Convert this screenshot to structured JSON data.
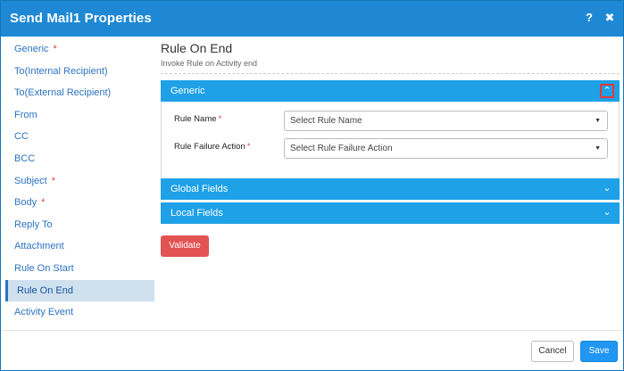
{
  "dialog": {
    "title": "Send Mail1 Properties",
    "help_icon": "?",
    "close_icon": "✖"
  },
  "sidebar": {
    "items": [
      {
        "label": "Generic",
        "required": "*"
      },
      {
        "label": "To(Internal Recipient)",
        "required": ""
      },
      {
        "label": "To(External Recipient)",
        "required": ""
      },
      {
        "label": "From",
        "required": ""
      },
      {
        "label": "CC",
        "required": ""
      },
      {
        "label": "BCC",
        "required": ""
      },
      {
        "label": "Subject",
        "required": "*"
      },
      {
        "label": "Body",
        "required": "*"
      },
      {
        "label": "Reply To",
        "required": ""
      },
      {
        "label": "Attachment",
        "required": ""
      },
      {
        "label": "Rule On Start",
        "required": ""
      },
      {
        "label": "Rule On End",
        "required": "",
        "active": true
      },
      {
        "label": "Activity Event",
        "required": ""
      }
    ]
  },
  "main": {
    "title": "Rule On End",
    "subtitle": "Invoke Rule on Activity end",
    "generic_panel": {
      "label": "Generic",
      "chevron": "⌃",
      "fields": [
        {
          "label": "Rule Name",
          "required": "*",
          "placeholder": "Select Rule Name"
        },
        {
          "label": "Rule Failure Action",
          "required": "*",
          "placeholder": "Select Rule Failure Action"
        }
      ]
    },
    "global_panel": {
      "label": "Global Fields",
      "chevron": "⌄"
    },
    "local_panel": {
      "label": "Local Fields",
      "chevron": "⌄"
    },
    "validate_label": "Validate"
  },
  "footer": {
    "cancel_label": "Cancel",
    "save_label": "Save"
  },
  "colors": {
    "title_bar": "#1e88d4",
    "panel_header": "#1fa1e8",
    "active_item_bg": "#cfe0ef",
    "validate_button": "#e35353",
    "save_button": "#2196f3",
    "required_mark": "#e03e3e"
  }
}
